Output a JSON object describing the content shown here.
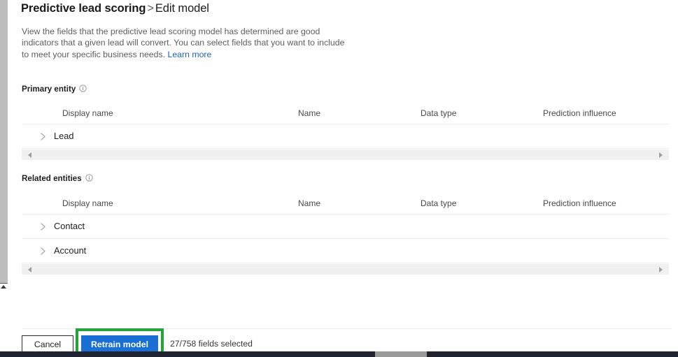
{
  "header": {
    "breadcrumb_parent": "Predictive lead scoring",
    "breadcrumb_separator": ">",
    "breadcrumb_current": "Edit model"
  },
  "description": {
    "text": "View the fields that the predictive lead scoring model has determined are good indicators that a given lead will convert. You can select fields that you want to include to meet your specific business needs.",
    "link_label": "Learn more"
  },
  "columns": {
    "display_name": "Display name",
    "name": "Name",
    "data_type": "Data type",
    "prediction_influence": "Prediction influence"
  },
  "primary_entity": {
    "label": "Primary entity",
    "info_icon": "info-icon",
    "rows": [
      {
        "display_name": "Lead",
        "expand_icon": "chevron-right-icon",
        "expanded": false
      }
    ]
  },
  "related_entities": {
    "label": "Related entities",
    "info_icon": "info-icon",
    "rows": [
      {
        "display_name": "Contact",
        "expand_icon": "chevron-right-icon",
        "expanded": false
      },
      {
        "display_name": "Account",
        "expand_icon": "chevron-right-icon",
        "expanded": false
      }
    ]
  },
  "scrollbars": {
    "left_arrow_icon": "caret-left-icon",
    "right_arrow_icon": "caret-right-icon",
    "vertical_arrow_icon": "caret-down-icon"
  },
  "footer": {
    "cancel_label": "Cancel",
    "retrain_label": "Retrain model",
    "fields_selected": "27/758 fields selected"
  },
  "colors": {
    "primary_button": "#1a6fd4",
    "focus_highlight": "#21a53a",
    "link": "#1f62b8",
    "text": "#242424",
    "muted_text": "#5e5e5e",
    "scrollbar_track": "#f0f0f0",
    "scrollbar_thumb": "#bdbdbd"
  }
}
